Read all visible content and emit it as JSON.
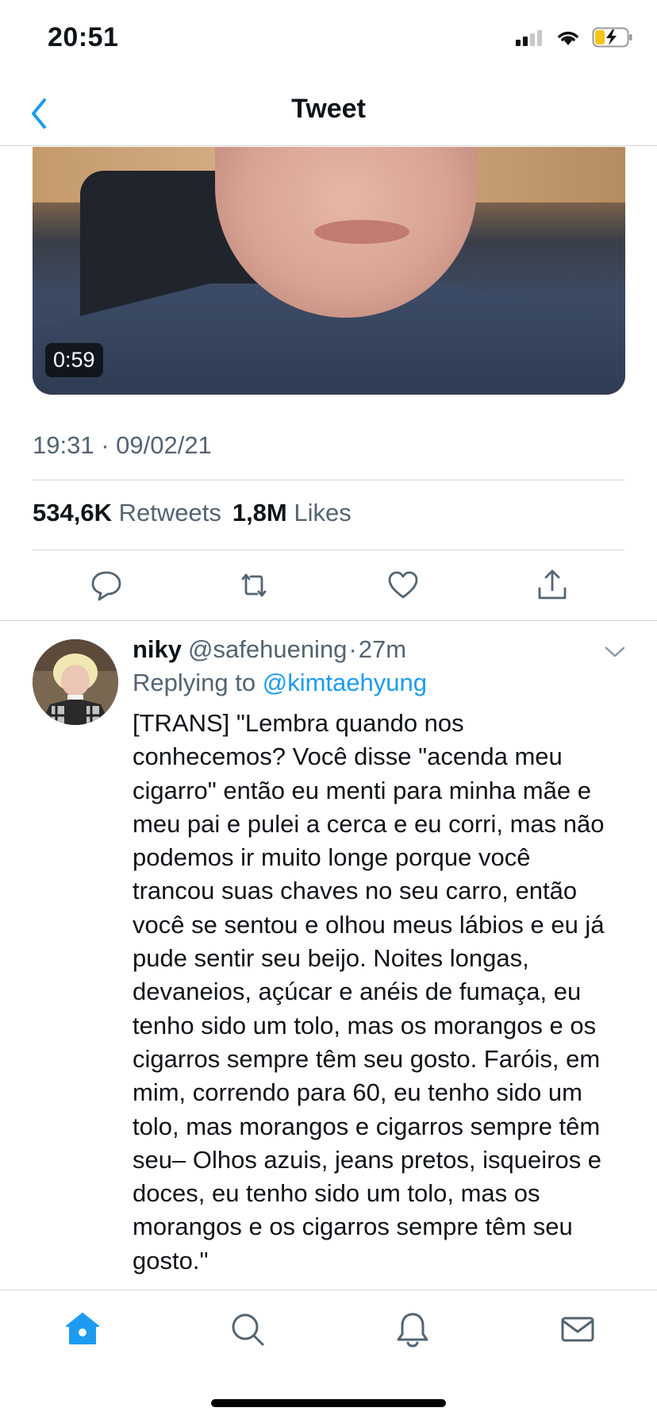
{
  "status_bar": {
    "time": "20:51"
  },
  "nav": {
    "title": "Tweet"
  },
  "video": {
    "duration": "0:59"
  },
  "tweet": {
    "timestamp": "19:31 · 09/02/21",
    "retweets_count": "534,6K",
    "retweets_label": "Retweets",
    "likes_count": "1,8M",
    "likes_label": "Likes"
  },
  "reply": {
    "name": "niky",
    "handle": "@safehuening",
    "separator": "·",
    "time": "27m",
    "replying_prefix": "Replying to",
    "replying_to": "@kimtaehyung",
    "lines": [
      "[TRANS] \"Lembra quando nos",
      "conhecemos? Você disse \"acenda meu",
      "cigarro\" então eu menti para minha mãe e",
      "meu pai e pulei a cerca e eu corri, mas não",
      "podemos ir muito longe porque você",
      "trancou suas chaves no seu carro, então",
      "você se sentou e olhou meus lábios e eu já",
      "pude sentir seu beijo. Noites longas,",
      "devaneios, açúcar e anéis de fumaça, eu",
      "tenho sido um tolo, mas os morangos e os",
      "cigarros sempre têm seu gosto. Faróis, em",
      "mim, correndo para 60, eu tenho sido um",
      "tolo, mas morangos e cigarros sempre têm",
      "seu– Olhos azuis, jeans pretos, isqueiros e",
      "doces, eu tenho sido um tolo, mas os",
      "morangos e os cigarros sempre têm seu",
      "gosto.\""
    ]
  },
  "colors": {
    "accent": "#1d9bf0",
    "secondary_text": "#536471",
    "divider": "#d0d5d9"
  },
  "icons": {
    "actions": [
      "reply-icon",
      "retweet-icon",
      "like-icon",
      "share-icon"
    ],
    "tabs": [
      "home-icon",
      "search-icon",
      "notifications-icon",
      "messages-icon"
    ]
  }
}
